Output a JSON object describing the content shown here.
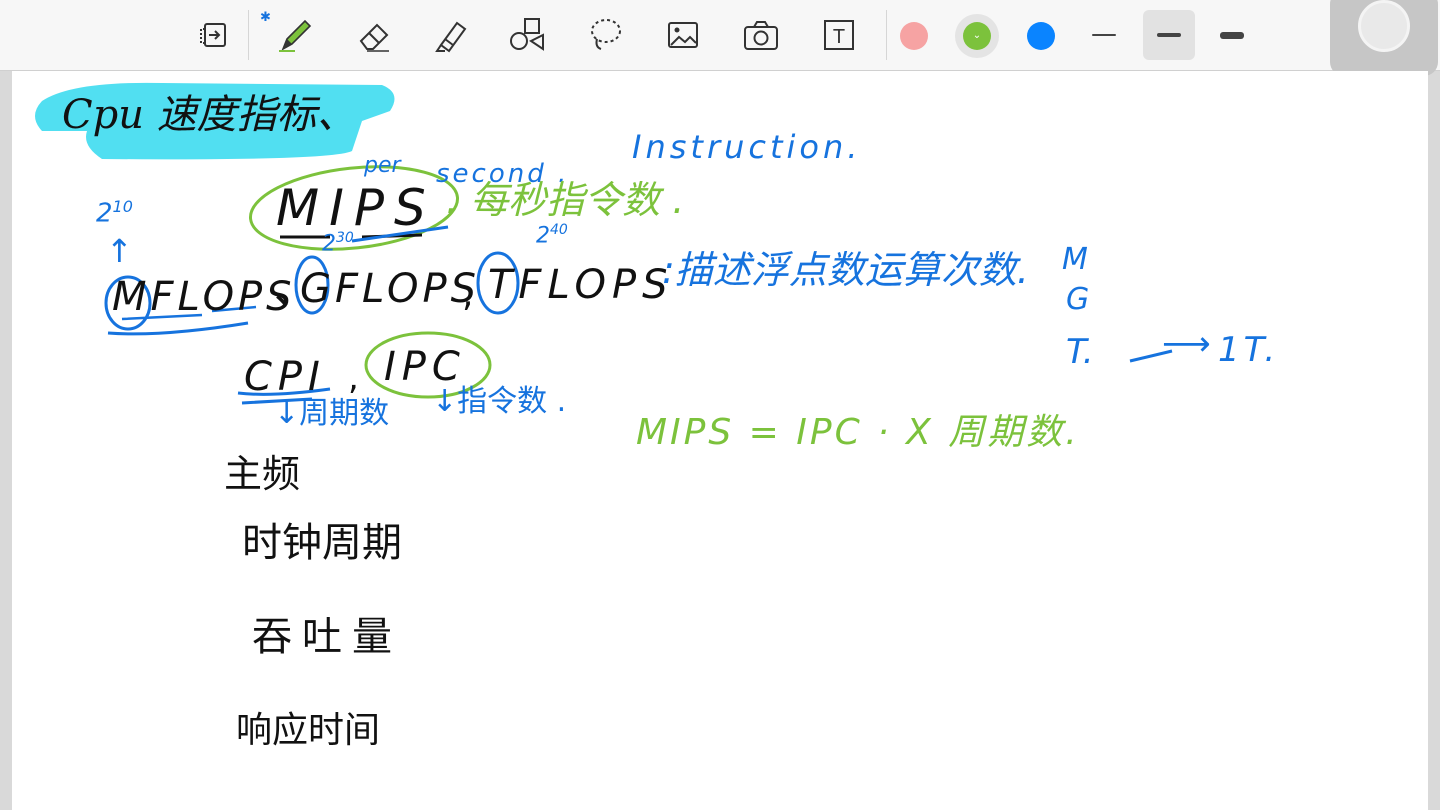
{
  "toolbar": {
    "tools": [
      {
        "name": "page-view-icon"
      },
      {
        "name": "pen-icon"
      },
      {
        "name": "eraser-icon"
      },
      {
        "name": "highlighter-icon"
      },
      {
        "name": "shapes-icon"
      },
      {
        "name": "lasso-icon"
      },
      {
        "name": "image-icon"
      },
      {
        "name": "camera-icon"
      },
      {
        "name": "text-box-icon"
      }
    ],
    "text_tool_glyph": "T",
    "colors": [
      "#f6a3a3",
      "#7cc23c",
      "#0a84ff"
    ],
    "selected_color": "#7cc23c",
    "stroke_widths": [
      "thin",
      "medium",
      "thick"
    ],
    "selected_width": "medium"
  },
  "note": {
    "title": "Cpu 速度指标、",
    "mips": "MIPS",
    "per_label": "per",
    "second_label": "second .",
    "instruction_label": "Instruction.",
    "mips_desc": ". 每秒指令数 .",
    "exp_2_10": "2",
    "exp_10": "10",
    "exp_2_30": "2",
    "exp_30": "30",
    "exp_2_40": "2",
    "exp_40": "40",
    "arrow_up": "↑",
    "flops_m": "MFLOPS",
    "sep1": "、",
    "flops_g": "GFLOPS",
    "sep2": ",",
    "flops_t": "TFLOPS",
    "flops_desc": ":描述浮点数运算次数.",
    "units_m": "M",
    "units_g": "G",
    "units_t": "T.",
    "units_arrow": "⟶",
    "units_result": "1T.",
    "cpi": "CPI",
    "sep3": ",",
    "ipc": "IPC",
    "cpi_note": "↓周期数",
    "ipc_note": "↓指令数 .",
    "formula": "MIPS = IPC · X 周期数.",
    "item1": "主频",
    "item2": "时钟周期",
    "item3": "吞吐量",
    "item4": "响应时间"
  },
  "ink_colors": {
    "black": "#111111",
    "blue": "#1673de",
    "green": "#7cc23c",
    "highlight": "#33d9ee"
  }
}
